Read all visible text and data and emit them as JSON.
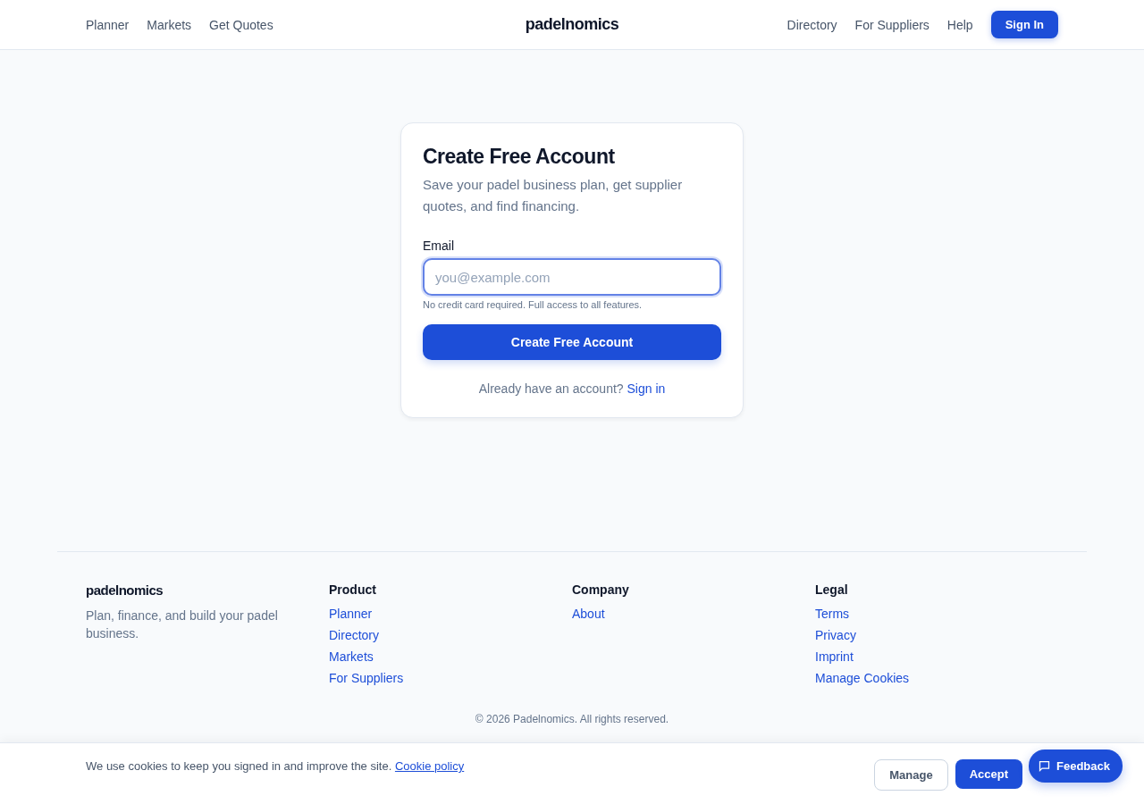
{
  "header": {
    "left_links": [
      "Planner",
      "Markets",
      "Get Quotes"
    ],
    "logo": "padelnomics",
    "right_links": [
      "Directory",
      "For Suppliers",
      "Help"
    ],
    "sign_in": "Sign In"
  },
  "card": {
    "title": "Create Free Account",
    "subtitle": "Save your padel business plan, get supplier quotes, and find financing.",
    "email_label": "Email",
    "email_placeholder": "you@example.com",
    "hint": "No credit card required. Full access to all features.",
    "submit": "Create Free Account",
    "signin_prompt": "Already have an account?",
    "signin_link": "Sign in"
  },
  "footer": {
    "logo": "padelnomics",
    "tagline": "Plan, finance, and build your padel business.",
    "columns": [
      {
        "title": "Product",
        "links": [
          "Planner",
          "Directory",
          "Markets",
          "For Suppliers"
        ]
      },
      {
        "title": "Company",
        "links": [
          "About"
        ]
      },
      {
        "title": "Legal",
        "links": [
          "Terms",
          "Privacy",
          "Imprint",
          "Manage Cookies"
        ]
      }
    ],
    "copyright": "© 2026 Padelnomics. All rights reserved."
  },
  "cookie_bar": {
    "text": "We use cookies to keep you signed in and improve the site.",
    "link": "Cookie policy",
    "manage": "Manage",
    "accept": "Accept"
  },
  "feedback": "Feedback"
}
